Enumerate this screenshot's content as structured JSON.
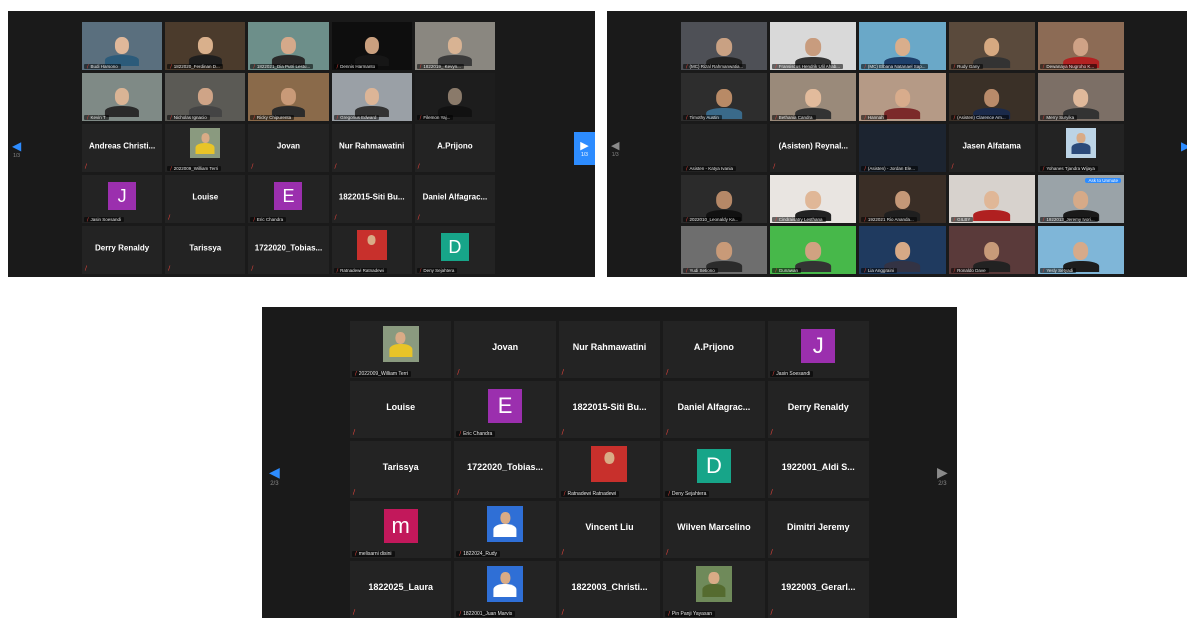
{
  "panels": [
    {
      "id": "panel1",
      "page": "1/3",
      "tiles": [
        {
          "type": "video",
          "label": "Budi Harsono",
          "bg": "#5a6f7e",
          "skin": "#e0b89a",
          "shirt": "#2c5b7a"
        },
        {
          "type": "video",
          "label": "1822020_Ferdinan D...",
          "bg": "#4b3b2c",
          "skin": "#d9b08c",
          "shirt": "#1e1e1e"
        },
        {
          "type": "video",
          "label": "1822021_Dia Putri Lestu...",
          "bg": "#6d8f8a",
          "skin": "#d5a98a",
          "shirt": "#2a2a2a"
        },
        {
          "type": "video",
          "label": "Dennis Harmanto",
          "bg": "#0e0e0e",
          "skin": "#caa07f",
          "shirt": "#161616"
        },
        {
          "type": "video",
          "label": "1822019_ Kevyn...",
          "bg": "#8a8780",
          "skin": "#d8b393",
          "shirt": "#3b3b3b"
        },
        {
          "type": "video",
          "label": "Kevin T",
          "bg": "#7f8a86",
          "skin": "#dab495",
          "shirt": "#2a2a2a"
        },
        {
          "type": "video",
          "label": "Nicholas Ignacio",
          "bg": "#5b5a55",
          "skin": "#cfa487",
          "shirt": "#444"
        },
        {
          "type": "video",
          "label": "Ricky Chipurenta",
          "bg": "#8a6a4a",
          "skin": "#c99a78",
          "shirt": "#2b2b2b"
        },
        {
          "type": "video",
          "label": "Gregorius Edward",
          "bg": "#9aa0a6",
          "skin": "#dcb597",
          "shirt": "#333"
        },
        {
          "type": "video",
          "label": "Filemon Yaj...",
          "bg": "#1d1d1d",
          "skin": "#8a7a6a",
          "shirt": "#111"
        },
        {
          "type": "name",
          "name": "Andreas Christi..."
        },
        {
          "type": "photo",
          "label": "2022009_William Terri",
          "photo_bg": "#8a9a7f",
          "shirt": "#e8c428"
        },
        {
          "type": "name",
          "name": "Jovan"
        },
        {
          "type": "name",
          "name": "Nur Rahmawatini"
        },
        {
          "type": "name",
          "name": "A.Prijono"
        },
        {
          "type": "avatar",
          "letter": "J",
          "color": "#9b2fae",
          "label": "Jasin Soesandi"
        },
        {
          "type": "name",
          "name": "Louise"
        },
        {
          "type": "avatar",
          "letter": "E",
          "color": "#9b2fae",
          "label": "Eric Chandra"
        },
        {
          "type": "name",
          "name": "1822015-Siti Bu..."
        },
        {
          "type": "name",
          "name": "Daniel  Alfagrac..."
        },
        {
          "type": "name",
          "name": "Derry Renaldy"
        },
        {
          "type": "name",
          "name": "Tarissya"
        },
        {
          "type": "name",
          "name": "1722020_Tobias..."
        },
        {
          "type": "photo",
          "label": "Ratnadewi Ratnadewi",
          "photo_bg": "#c8302c",
          "shirt": "#c8302c"
        },
        {
          "type": "avatar",
          "letter": "D",
          "color": "#17a589",
          "label": "Deny Sejahtera"
        }
      ]
    },
    {
      "id": "panel2",
      "page": "1/3",
      "tiles": [
        {
          "type": "video",
          "label": "(MC) Rizal Rahmanwatia...",
          "bg": "#4e5056",
          "skin": "#c9a183",
          "shirt": "#222"
        },
        {
          "type": "video",
          "label": "Fransiscus Hendrik Ulil Ahab...",
          "bg": "#d9d9d9",
          "skin": "#c89c7e",
          "shirt": "#333"
        },
        {
          "type": "video",
          "label": "(MC) Elbana Natanael Sap...",
          "bg": "#6aa8c8",
          "skin": "#d9ae8c",
          "shirt": "#1e3f6a",
          "active": true
        },
        {
          "type": "video",
          "label": "Rudy Gany",
          "bg": "#5a4a3c",
          "skin": "#d6a981",
          "shirt": "#333"
        },
        {
          "type": "video",
          "label": "Dewanaya Nugroho K...",
          "bg": "#8c6b55",
          "skin": "#cfa286",
          "shirt": "#b22222"
        },
        {
          "type": "video",
          "label": "Timothy Austin",
          "bg": "#2d2d2d",
          "skin": "#b88a66",
          "shirt": "#3a6a8a"
        },
        {
          "type": "video",
          "label": "Bethania Candra",
          "bg": "#9a8a7a",
          "skin": "#e2bb9c",
          "shirt": "#333"
        },
        {
          "type": "video",
          "label": "Hannah",
          "bg": "#b59a86",
          "skin": "#d8ac8c",
          "shirt": "#7b2a2a"
        },
        {
          "type": "video",
          "label": "(Asisten) Clarence Am...",
          "bg": "#3a3027",
          "skin": "#b98b6a",
          "shirt": "#1b2a4a"
        },
        {
          "type": "video",
          "label": "Merry Suryika",
          "bg": "#7c6f66",
          "skin": "#e0b99b",
          "shirt": "#333"
        },
        {
          "type": "mic",
          "label": "Asisten - Katya Ivania"
        },
        {
          "type": "name",
          "name": "(Asisten)  Reynal..."
        },
        {
          "type": "video",
          "label": "(Asisten) - Jordan Ele...",
          "bg": "#1c2430",
          "skin": "#1c2430",
          "shirt": "#1c2430"
        },
        {
          "type": "name",
          "name": "Jasen Alfatama"
        },
        {
          "type": "photo",
          "label": "Yohanes Tjandra Wijaya",
          "photo_bg": "#bcd4e6",
          "shirt": "#2b4a7a"
        },
        {
          "type": "video",
          "label": "2022010_Leonaldy Ka...",
          "bg": "#2b2b2b",
          "skin": "#b58867",
          "shirt": "#111"
        },
        {
          "type": "video",
          "label": "Cindraisatry Lesthana",
          "bg": "#e9e5e1",
          "skin": "#e0b797",
          "shirt": "#222"
        },
        {
          "type": "video",
          "label": "1922021 Rio Ananda...",
          "bg": "#3a2e26",
          "skin": "#c59877",
          "shirt": "#1f1f1f"
        },
        {
          "type": "video",
          "label": "GILBY",
          "bg": "#d7d2cd",
          "skin": "#e0b797",
          "shirt": "#b02020"
        },
        {
          "type": "video",
          "label": "1922013_Jeremy Ivori...",
          "bg": "#9aa3a8",
          "skin": "#d6aa88",
          "shirt": "#1a1a1a",
          "live": "Ask to Unmute"
        },
        {
          "type": "video",
          "label": "Yudi Setiono",
          "bg": "#6e6e6e",
          "skin": "#c89a78",
          "shirt": "#2b2b2b"
        },
        {
          "type": "video",
          "label": "Gunawan",
          "bg": "#47b84a",
          "skin": "#d0a281",
          "shirt": "#333"
        },
        {
          "type": "video",
          "label": "Lia Anggraini",
          "bg": "#1f3a5f",
          "skin": "#d6a986",
          "shirt": "#334"
        },
        {
          "type": "video",
          "label": "Ronaldo Dave",
          "bg": "#5a3a3a",
          "skin": "#c79a79",
          "shirt": "#222"
        },
        {
          "type": "video",
          "label": "Yesly Setyadi",
          "bg": "#7fb6d8",
          "skin": "#d6aa8a",
          "shirt": "#1d1d1d"
        }
      ]
    },
    {
      "id": "panel3",
      "page_left": "2/3",
      "page_right": "2/3",
      "tiles": [
        {
          "type": "photo",
          "label": "2022009_William Terri",
          "photo_bg": "#8a9a7f",
          "shirt": "#e8c428"
        },
        {
          "type": "name",
          "name": "Jovan"
        },
        {
          "type": "name",
          "name": "Nur Rahmawatini"
        },
        {
          "type": "name",
          "name": "A.Prijono"
        },
        {
          "type": "avatar",
          "letter": "J",
          "color": "#9b2fae",
          "label": "Jasin Soesandi"
        },
        {
          "type": "name",
          "name": "Louise"
        },
        {
          "type": "avatar",
          "letter": "E",
          "color": "#9b2fae",
          "label": "Eric Chandra"
        },
        {
          "type": "name",
          "name": "1822015-Siti Bu..."
        },
        {
          "type": "name",
          "name": "Daniel  Alfagrac..."
        },
        {
          "type": "name",
          "name": "Derry Renaldy"
        },
        {
          "type": "name",
          "name": "Tarissya"
        },
        {
          "type": "name",
          "name": "1722020_Tobias..."
        },
        {
          "type": "photo",
          "label": "Ratnadewi Ratnadewi",
          "photo_bg": "#c8302c",
          "shirt": "#c8302c"
        },
        {
          "type": "avatar",
          "letter": "D",
          "color": "#17a589",
          "label": "Deny Sejahtera"
        },
        {
          "type": "name",
          "name": "1922001_Aldi S..."
        },
        {
          "type": "avatar",
          "letter": "m",
          "color": "#c2185b",
          "label": "melisarni disini"
        },
        {
          "type": "photo",
          "label": "1822024_Rudy",
          "photo_bg": "#2f6fd6",
          "shirt": "#ffffff"
        },
        {
          "type": "name",
          "name": "Vincent Liu"
        },
        {
          "type": "name",
          "name": "Wilven Marcelino"
        },
        {
          "type": "name",
          "name": "Dimitri Jeremy"
        },
        {
          "type": "name",
          "name": "1822025_Laura"
        },
        {
          "type": "photo",
          "label": "1822001_Juan Marvis",
          "photo_bg": "#2f6fd6",
          "shirt": "#ffffff"
        },
        {
          "type": "name",
          "name": "1822003_Christi..."
        },
        {
          "type": "photo",
          "label": "Pin Panji Yayasan",
          "photo_bg": "#6f8a5a",
          "shirt": "#556b2f"
        },
        {
          "type": "name",
          "name": "1922003_Gerarl..."
        }
      ]
    }
  ]
}
